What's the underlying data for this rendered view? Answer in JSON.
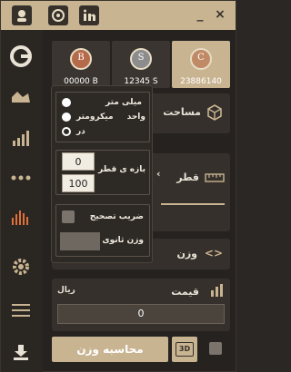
{
  "titlebar": {
    "min_label": "_",
    "close_label": "×"
  },
  "sidebar": {
    "items": [
      {
        "icon": "logo-icon"
      },
      {
        "icon": "area-chart-icon"
      },
      {
        "icon": "bar-chart-icon"
      },
      {
        "icon": "more-icon"
      },
      {
        "icon": "histogram-icon"
      },
      {
        "icon": "gear-icon"
      },
      {
        "icon": "menu-icon"
      },
      {
        "icon": "download-icon"
      }
    ]
  },
  "tabs": [
    {
      "coin": "B",
      "label": "00000 B"
    },
    {
      "coin": "S",
      "label": "12345 S"
    },
    {
      "coin": "C",
      "label": "23886140"
    }
  ],
  "sections": {
    "area_label": "مساحت",
    "diameter_label": "قطر",
    "weight_label": "وزن",
    "price_label": "قیمت",
    "price_unit": "ریال",
    "price_value": "0"
  },
  "popover": {
    "unit_label": "واحد",
    "units": [
      "میلی متر",
      "میکرومتر",
      "در"
    ],
    "range_label": "بازه ی قطر",
    "range_min": "0",
    "range_max": "100",
    "coef_label": "ضریب تصحیح",
    "secondary_weight_label": "وزن ثانوی"
  },
  "footer": {
    "calc_label": "محاسبه وزن",
    "btn3d_label": "3D"
  },
  "colors": {
    "accent": "#c9b492",
    "background": "#25221f",
    "panel": "#35302b"
  }
}
